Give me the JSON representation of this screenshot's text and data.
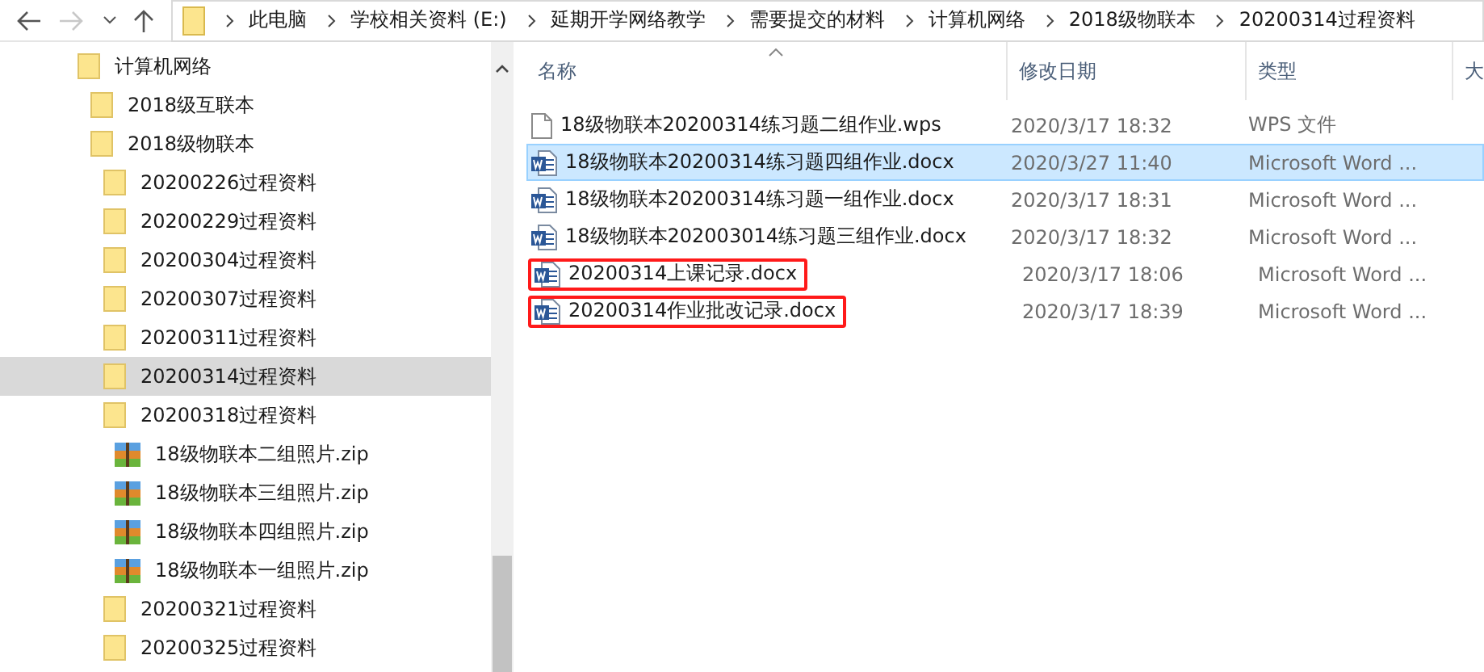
{
  "breadcrumb": [
    "此电脑",
    "学校相关资料 (E:)",
    "延期开学网络教学",
    "需要提交的材料",
    "计算机网络",
    "2018级物联本",
    "20200314过程资料"
  ],
  "nav_buttons": {
    "back_disabled": false,
    "forward_disabled": true
  },
  "tree": [
    {
      "label": "计算机网络",
      "kind": "folder",
      "selected": false,
      "children": [
        {
          "label": "2018级互联本",
          "kind": "folder",
          "selected": false
        },
        {
          "label": "2018级物联本",
          "kind": "folder",
          "selected": false,
          "children": [
            {
              "label": "20200226过程资料",
              "kind": "folder",
              "selected": false
            },
            {
              "label": "20200229过程资料",
              "kind": "folder",
              "selected": false
            },
            {
              "label": "20200304过程资料",
              "kind": "folder",
              "selected": false
            },
            {
              "label": "20200307过程资料",
              "kind": "folder",
              "selected": false
            },
            {
              "label": "20200311过程资料",
              "kind": "folder",
              "selected": false
            },
            {
              "label": "20200314过程资料",
              "kind": "folder",
              "selected": true
            },
            {
              "label": "20200318过程资料",
              "kind": "folder",
              "selected": false,
              "children": [
                {
                  "label": "18级物联本二组照片.zip",
                  "kind": "archive",
                  "selected": false
                },
                {
                  "label": "18级物联本三组照片.zip",
                  "kind": "archive",
                  "selected": false
                },
                {
                  "label": "18级物联本四组照片.zip",
                  "kind": "archive",
                  "selected": false
                },
                {
                  "label": "18级物联本一组照片.zip",
                  "kind": "archive",
                  "selected": false
                }
              ]
            },
            {
              "label": "20200321过程资料",
              "kind": "folder",
              "selected": false
            },
            {
              "label": "20200325过程资料",
              "kind": "folder",
              "selected": false
            }
          ]
        }
      ]
    }
  ],
  "columns": [
    "名称",
    "修改日期",
    "类型",
    "大"
  ],
  "files": [
    {
      "name": "18级物联本20200314练习题二组作业.wps",
      "date": "2020/3/17 18:32",
      "type": "WPS 文件",
      "kind": "wps",
      "selected": false,
      "marked": false
    },
    {
      "name": "18级物联本20200314练习题四组作业.docx",
      "date": "2020/3/27 11:40",
      "type": "Microsoft Word ...",
      "kind": "word",
      "selected": true,
      "marked": false
    },
    {
      "name": "18级物联本20200314练习题一组作业.docx",
      "date": "2020/3/17 18:31",
      "type": "Microsoft Word ...",
      "kind": "word",
      "selected": false,
      "marked": false
    },
    {
      "name": "18级物联本202003014练习题三组作业.docx",
      "date": "2020/3/17 18:32",
      "type": "Microsoft Word ...",
      "kind": "word",
      "selected": false,
      "marked": false
    },
    {
      "name": "20200314上课记录.docx",
      "date": "2020/3/17 18:06",
      "type": "Microsoft Word ...",
      "kind": "word",
      "selected": false,
      "marked": true
    },
    {
      "name": "20200314作业批改记录.docx",
      "date": "2020/3/17 18:39",
      "type": "Microsoft Word ...",
      "kind": "word",
      "selected": false,
      "marked": true
    }
  ]
}
